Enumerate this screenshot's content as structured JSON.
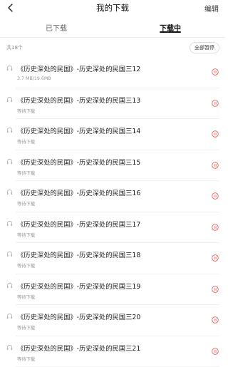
{
  "header": {
    "title": "我的下载",
    "edit_label": "编辑"
  },
  "tabs": [
    {
      "label": "已下载",
      "active": false
    },
    {
      "label": "下载中",
      "active": true
    }
  ],
  "summary": {
    "total": "共18个",
    "pause_all_label": "全部暂停"
  },
  "colors": {
    "accent": "#e8554e",
    "text": "#222222",
    "muted": "#999999"
  },
  "icons": {
    "back": "chevron-left-icon",
    "item": "headphones-icon",
    "action": "pause-circle-icon"
  },
  "items": [
    {
      "title": "《历史深处的民国》-历史深处的民国三12",
      "status": "3.7 MB/19.6MB"
    },
    {
      "title": "《历史深处的民国》-历史深处的民国三13",
      "status": "等待下载"
    },
    {
      "title": "《历史深处的民国》-历史深处的民国三14",
      "status": "等待下载"
    },
    {
      "title": "《历史深处的民国》-历史深处的民国三15",
      "status": "等待下载"
    },
    {
      "title": "《历史深处的民国》-历史深处的民国三16",
      "status": "等待下载"
    },
    {
      "title": "《历史深处的民国》-历史深处的民国三17",
      "status": "等待下载"
    },
    {
      "title": "《历史深处的民国》-历史深处的民国三18",
      "status": "等待下载"
    },
    {
      "title": "《历史深处的民国》-历史深处的民国三19",
      "status": "等待下载"
    },
    {
      "title": "《历史深处的民国》-历史深处的民国三20",
      "status": "等待下载"
    },
    {
      "title": "《历史深处的民国》-历史深处的民国三21",
      "status": "等待下载"
    }
  ]
}
